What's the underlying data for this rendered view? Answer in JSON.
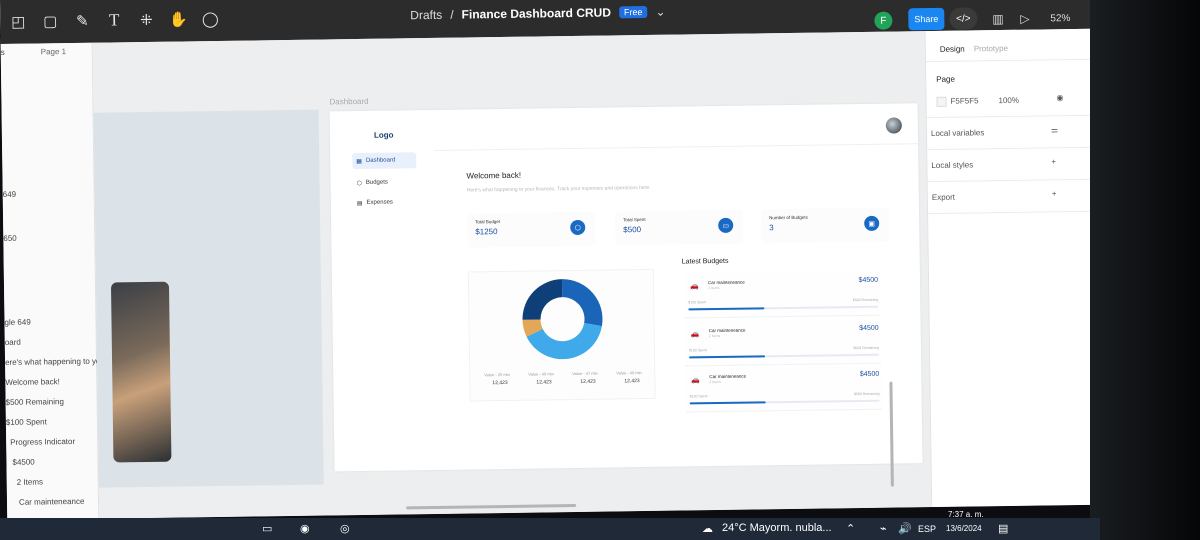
{
  "toolbar": {
    "drafts": "Drafts",
    "separator": "/",
    "file_name": "Finance Dashboard CRUD",
    "plan_badge": "Free",
    "user_initial": "F",
    "share_label": "Share",
    "zoom": "52%"
  },
  "layers": {
    "page_label": "Page 1",
    "rows": [
      "s",
      "649",
      "650",
      "gle 649",
      "oard",
      "ere's what happening to you...",
      "Welcome back!",
      "$500 Remaining",
      "$100 Spent",
      "Progress Indicator",
      "$4500",
      "2 Items",
      "Car mainteneance"
    ]
  },
  "canvas": {
    "frame_label": "Dashboard"
  },
  "dashboard": {
    "logo": "Logo",
    "nav": [
      "Dashboard",
      "Budgets",
      "Expenses"
    ],
    "welcome": "Welcome back!",
    "subtitle": "Here's what happening to your finances. Track your expenses and operations here.",
    "stats": [
      {
        "label": "Total Budget",
        "value": "$1250"
      },
      {
        "label": "Total Spent",
        "value": "$500"
      },
      {
        "label": "Number of Budgets",
        "value": "3"
      }
    ],
    "chart_legend": [
      {
        "label": "Value - 20 min",
        "value": "12,423"
      },
      {
        "label": "Value - 40 min",
        "value": "12,423"
      },
      {
        "label": "Value - 47 min",
        "value": "12,423"
      },
      {
        "label": "Value - 40 min",
        "value": "12,423"
      }
    ],
    "latest_title": "Latest Budgets",
    "budgets": [
      {
        "name": "Car mainteneance",
        "items": "2 Items",
        "amount": "$4500",
        "spent": "$100 Spent",
        "remaining": "$500 Remaining",
        "progress": 0.4
      },
      {
        "name": "Car mainteneance",
        "items": "2 Items",
        "amount": "$4500",
        "spent": "$100 Spent",
        "remaining": "$500 Remaining",
        "progress": 0.4
      },
      {
        "name": "Car mainteneance",
        "items": "2 Items",
        "amount": "$4500",
        "spent": "$100 Spent",
        "remaining": "$500 Remaining",
        "progress": 0.4
      }
    ]
  },
  "donut": {
    "colors": [
      "#1a65b8",
      "#3fa9ea",
      "#e3a857",
      "#0f3f78"
    ],
    "shares": [
      0.28,
      0.4,
      0.07,
      0.25
    ]
  },
  "props": {
    "tab_design": "Design",
    "tab_prototype": "Prototype",
    "page_section": "Page",
    "page_color": "F5F5F5",
    "page_opacity": "100%",
    "local_variables": "Local variables",
    "local_styles": "Local styles",
    "export": "Export"
  },
  "taskbar": {
    "weather": "24°C  Mayorm. nubla...",
    "lang": "ESP",
    "time": "7:37 a. m.",
    "date": "13/6/2024"
  }
}
